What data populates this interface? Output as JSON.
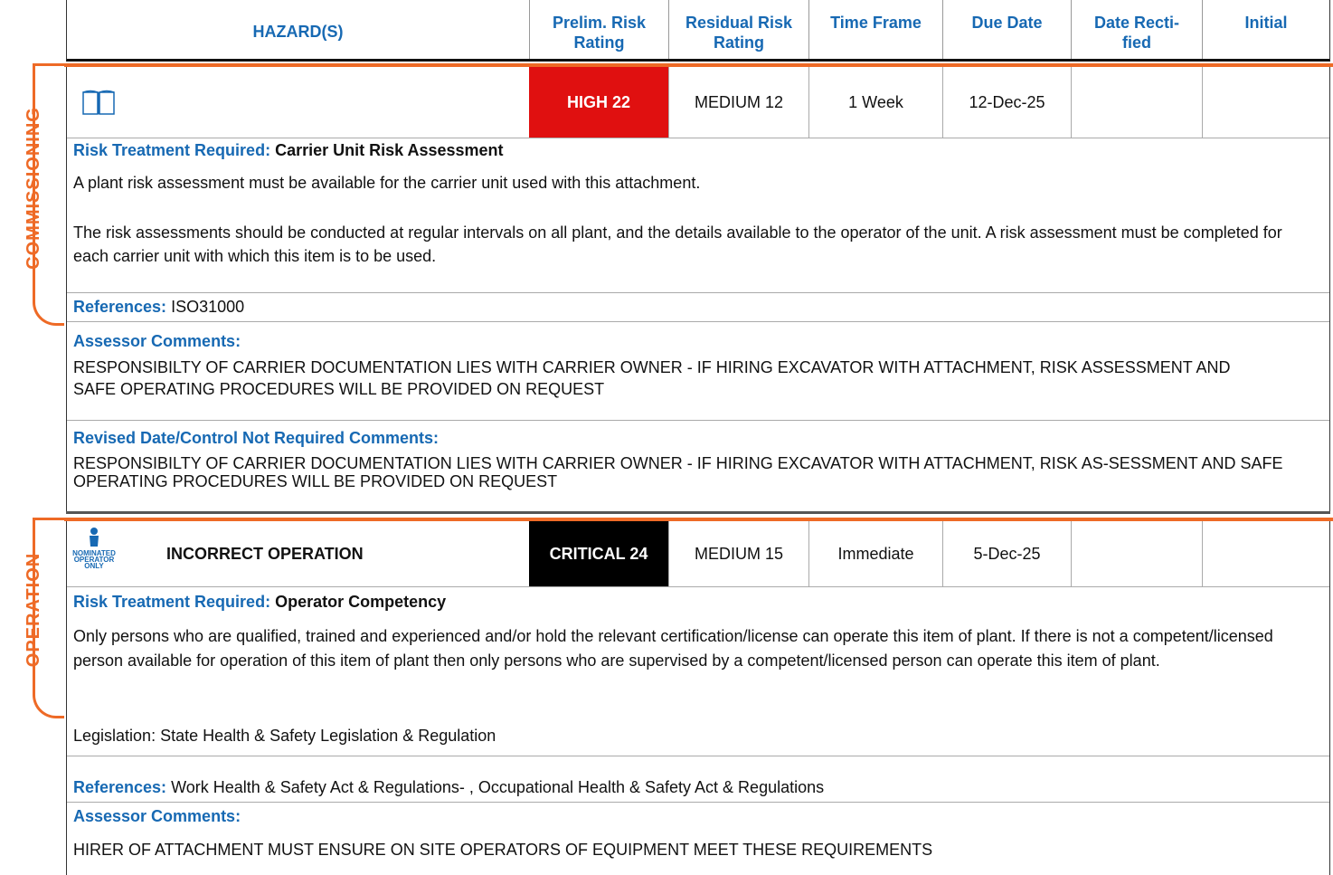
{
  "header": {
    "hazards": "HAZARD(S)",
    "prelim_risk": [
      "Prelim. Risk",
      "Rating"
    ],
    "residual_risk": [
      "Residual Risk",
      "Rating"
    ],
    "time_frame": "Time Frame",
    "due_date": "Due Date",
    "date_rectified": [
      "Date Recti-",
      "fied"
    ],
    "initial": "Initial"
  },
  "sections": [
    {
      "section_label": "COMMISSIONING",
      "icon": "book-icon",
      "hazard": "",
      "prelim_rating": "HIGH 22",
      "residual_rating": "MEDIUM 12",
      "time_frame": "1 Week",
      "due_date": "12-Dec-25",
      "date_rectified": "",
      "initial": "",
      "risk_treatment_label": "Risk Treatment Required:",
      "risk_treatment": "Carrier Unit Risk Assessment",
      "paragraphs": [
        "A plant risk assessment must be available for the carrier unit used with this attachment.",
        "The risk assessments should be conducted at regular intervals on all plant, and the details available to the operator of the unit. A risk assessment must be completed for each carrier unit with which this item is to be used."
      ],
      "references_label": "References:",
      "references": "ISO31000",
      "assessor_label": "Assessor Comments:",
      "assessor_comments": "RESPONSIBILTY OF CARRIER DOCUMENTATION LIES WITH CARRIER OWNER - IF HIRING EXCAVATOR WITH ATTACHMENT, RISK ASSESSMENT AND SAFE OPERATING PROCEDURES WILL BE PROVIDED ON REQUEST",
      "revised_label": "Revised Date/Control Not Required Comments:",
      "revised_comments": "RESPONSIBILTY OF CARRIER DOCUMENTATION LIES WITH CARRIER OWNER - IF HIRING EXCAVATOR WITH ATTACHMENT, RISK AS-SESSMENT AND SAFE OPERATING PROCEDURES WILL BE PROVIDED ON REQUEST"
    },
    {
      "section_label": "OPERATION",
      "icon": "nominated-operator-icon",
      "icon_text": [
        "NOMINATED",
        "OPERATOR",
        "ONLY"
      ],
      "hazard": "INCORRECT OPERATION",
      "prelim_rating": "CRITICAL 24",
      "residual_rating": "MEDIUM 15",
      "time_frame": "Immediate",
      "due_date": "5-Dec-25",
      "date_rectified": "",
      "initial": "",
      "risk_treatment_label": "Risk Treatment Required:",
      "risk_treatment": "Operator Competency",
      "paragraphs": [
        "Only persons who are qualified, trained and experienced and/or hold the relevant certification/license can operate this item of plant. If there is not a competent/licensed person available for operation of this item of plant then only persons who are supervised by a competent/licensed person can operate this item of plant.",
        "Legislation: State Health & Safety Legislation & Regulation"
      ],
      "references_label": "References:",
      "references": "Work Health & Safety Act & Regulations- , Occupational Health & Safety Act & Regulations",
      "assessor_label": "Assessor Comments:",
      "assessor_comments": "HIRER OF ATTACHMENT MUST ENSURE ON SITE OPERATORS OF EQUIPMENT MEET THESE REQUIREMENTS"
    }
  ],
  "colors": {
    "accent_orange": "#ee6a26",
    "label_blue": "#1769b3",
    "high_red": "#e01010",
    "critical_black": "#000000"
  }
}
